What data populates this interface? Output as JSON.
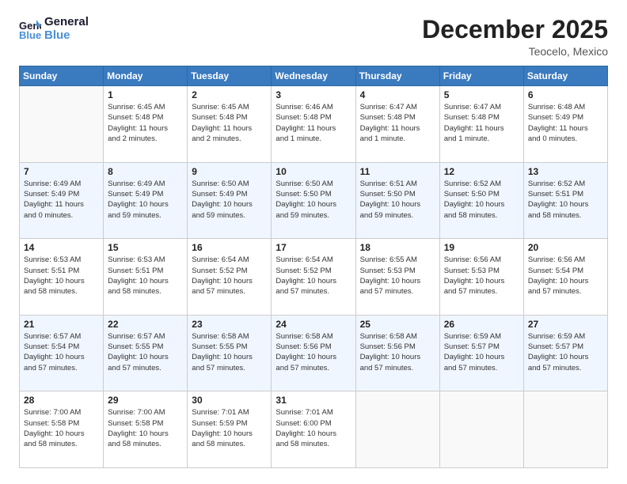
{
  "logo": {
    "line1": "General",
    "line2": "Blue"
  },
  "title": "December 2025",
  "location": "Teocelo, Mexico",
  "days_of_week": [
    "Sunday",
    "Monday",
    "Tuesday",
    "Wednesday",
    "Thursday",
    "Friday",
    "Saturday"
  ],
  "weeks": [
    [
      {
        "day": "",
        "info": ""
      },
      {
        "day": "1",
        "info": "Sunrise: 6:45 AM\nSunset: 5:48 PM\nDaylight: 11 hours\nand 2 minutes."
      },
      {
        "day": "2",
        "info": "Sunrise: 6:45 AM\nSunset: 5:48 PM\nDaylight: 11 hours\nand 2 minutes."
      },
      {
        "day": "3",
        "info": "Sunrise: 6:46 AM\nSunset: 5:48 PM\nDaylight: 11 hours\nand 1 minute."
      },
      {
        "day": "4",
        "info": "Sunrise: 6:47 AM\nSunset: 5:48 PM\nDaylight: 11 hours\nand 1 minute."
      },
      {
        "day": "5",
        "info": "Sunrise: 6:47 AM\nSunset: 5:48 PM\nDaylight: 11 hours\nand 1 minute."
      },
      {
        "day": "6",
        "info": "Sunrise: 6:48 AM\nSunset: 5:49 PM\nDaylight: 11 hours\nand 0 minutes."
      }
    ],
    [
      {
        "day": "7",
        "info": "Sunrise: 6:49 AM\nSunset: 5:49 PM\nDaylight: 11 hours\nand 0 minutes."
      },
      {
        "day": "8",
        "info": "Sunrise: 6:49 AM\nSunset: 5:49 PM\nDaylight: 10 hours\nand 59 minutes."
      },
      {
        "day": "9",
        "info": "Sunrise: 6:50 AM\nSunset: 5:49 PM\nDaylight: 10 hours\nand 59 minutes."
      },
      {
        "day": "10",
        "info": "Sunrise: 6:50 AM\nSunset: 5:50 PM\nDaylight: 10 hours\nand 59 minutes."
      },
      {
        "day": "11",
        "info": "Sunrise: 6:51 AM\nSunset: 5:50 PM\nDaylight: 10 hours\nand 59 minutes."
      },
      {
        "day": "12",
        "info": "Sunrise: 6:52 AM\nSunset: 5:50 PM\nDaylight: 10 hours\nand 58 minutes."
      },
      {
        "day": "13",
        "info": "Sunrise: 6:52 AM\nSunset: 5:51 PM\nDaylight: 10 hours\nand 58 minutes."
      }
    ],
    [
      {
        "day": "14",
        "info": "Sunrise: 6:53 AM\nSunset: 5:51 PM\nDaylight: 10 hours\nand 58 minutes."
      },
      {
        "day": "15",
        "info": "Sunrise: 6:53 AM\nSunset: 5:51 PM\nDaylight: 10 hours\nand 58 minutes."
      },
      {
        "day": "16",
        "info": "Sunrise: 6:54 AM\nSunset: 5:52 PM\nDaylight: 10 hours\nand 57 minutes."
      },
      {
        "day": "17",
        "info": "Sunrise: 6:54 AM\nSunset: 5:52 PM\nDaylight: 10 hours\nand 57 minutes."
      },
      {
        "day": "18",
        "info": "Sunrise: 6:55 AM\nSunset: 5:53 PM\nDaylight: 10 hours\nand 57 minutes."
      },
      {
        "day": "19",
        "info": "Sunrise: 6:56 AM\nSunset: 5:53 PM\nDaylight: 10 hours\nand 57 minutes."
      },
      {
        "day": "20",
        "info": "Sunrise: 6:56 AM\nSunset: 5:54 PM\nDaylight: 10 hours\nand 57 minutes."
      }
    ],
    [
      {
        "day": "21",
        "info": "Sunrise: 6:57 AM\nSunset: 5:54 PM\nDaylight: 10 hours\nand 57 minutes."
      },
      {
        "day": "22",
        "info": "Sunrise: 6:57 AM\nSunset: 5:55 PM\nDaylight: 10 hours\nand 57 minutes."
      },
      {
        "day": "23",
        "info": "Sunrise: 6:58 AM\nSunset: 5:55 PM\nDaylight: 10 hours\nand 57 minutes."
      },
      {
        "day": "24",
        "info": "Sunrise: 6:58 AM\nSunset: 5:56 PM\nDaylight: 10 hours\nand 57 minutes."
      },
      {
        "day": "25",
        "info": "Sunrise: 6:58 AM\nSunset: 5:56 PM\nDaylight: 10 hours\nand 57 minutes."
      },
      {
        "day": "26",
        "info": "Sunrise: 6:59 AM\nSunset: 5:57 PM\nDaylight: 10 hours\nand 57 minutes."
      },
      {
        "day": "27",
        "info": "Sunrise: 6:59 AM\nSunset: 5:57 PM\nDaylight: 10 hours\nand 57 minutes."
      }
    ],
    [
      {
        "day": "28",
        "info": "Sunrise: 7:00 AM\nSunset: 5:58 PM\nDaylight: 10 hours\nand 58 minutes."
      },
      {
        "day": "29",
        "info": "Sunrise: 7:00 AM\nSunset: 5:58 PM\nDaylight: 10 hours\nand 58 minutes."
      },
      {
        "day": "30",
        "info": "Sunrise: 7:01 AM\nSunset: 5:59 PM\nDaylight: 10 hours\nand 58 minutes."
      },
      {
        "day": "31",
        "info": "Sunrise: 7:01 AM\nSunset: 6:00 PM\nDaylight: 10 hours\nand 58 minutes."
      },
      {
        "day": "",
        "info": ""
      },
      {
        "day": "",
        "info": ""
      },
      {
        "day": "",
        "info": ""
      }
    ]
  ]
}
